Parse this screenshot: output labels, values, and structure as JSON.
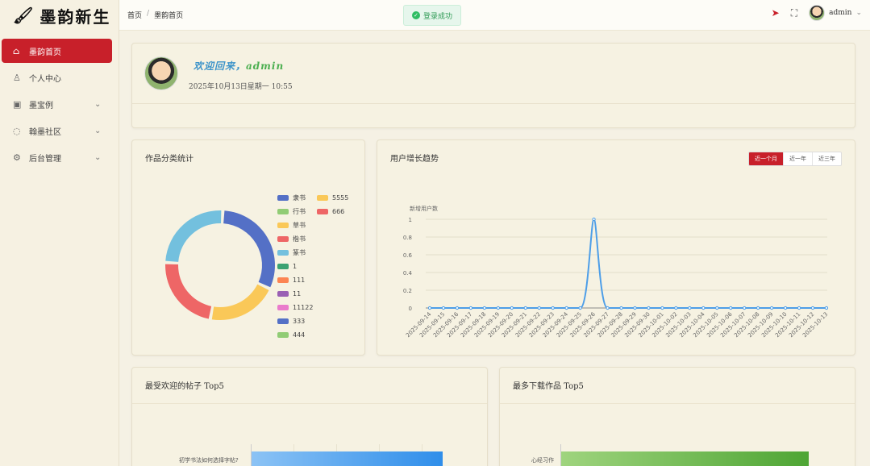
{
  "app": {
    "logo_text": "墨韵新生"
  },
  "sidebar": {
    "items": [
      {
        "label": "墨韵首页",
        "icon": "home-icon",
        "active": true,
        "has_children": false
      },
      {
        "label": "个人中心",
        "icon": "user-icon",
        "active": false,
        "has_children": false
      },
      {
        "label": "墨宝例",
        "icon": "image-icon",
        "active": false,
        "has_children": true
      },
      {
        "label": "翰墨社区",
        "icon": "chat-icon",
        "active": false,
        "has_children": true
      },
      {
        "label": "后台管理",
        "icon": "gear-icon",
        "active": false,
        "has_children": true
      }
    ]
  },
  "header": {
    "breadcrumb": [
      "首页",
      "墨韵首页"
    ],
    "breadcrumb_sep": "/",
    "toast": "登录成功",
    "username": "admin"
  },
  "welcome": {
    "title": "欢迎回来，",
    "name": "admin",
    "datetime": "2025年10月13日星期一 10:55"
  },
  "pie": {
    "title": "作品分类统计",
    "legend_col1": [
      {
        "label": "隶书",
        "color": "#5470c6"
      },
      {
        "label": "行书",
        "color": "#91cc75"
      },
      {
        "label": "草书",
        "color": "#fac858"
      },
      {
        "label": "楷书",
        "color": "#ee6666"
      },
      {
        "label": "篆书",
        "color": "#73c0de"
      },
      {
        "label": "1",
        "color": "#3ba272"
      },
      {
        "label": "111",
        "color": "#fc8452"
      },
      {
        "label": "11",
        "color": "#9a60b4"
      },
      {
        "label": "11122",
        "color": "#ea7ccc"
      },
      {
        "label": "333",
        "color": "#5470c6"
      },
      {
        "label": "444",
        "color": "#91cc75"
      }
    ],
    "legend_col2": [
      {
        "label": "5555",
        "color": "#fac858"
      },
      {
        "label": "666",
        "color": "#ee6666"
      }
    ]
  },
  "trend": {
    "title": "用户增长趋势",
    "tabs": [
      "近一个月",
      "近一年",
      "近三年"
    ],
    "active_tab": 0
  },
  "posts": {
    "title": "最受欢迎的帖子 Top5",
    "bar_label": "初学书法如何选择字帖?"
  },
  "downloads": {
    "title": "最多下载作品 Top5",
    "bar_label": "心经习作"
  },
  "colors": {
    "accent": "#c8202a",
    "line": "#4d9ee8"
  },
  "chart_data": [
    {
      "type": "pie",
      "title": "作品分类统计",
      "categories": [
        "隶书",
        "行书",
        "草书",
        "楷书",
        "篆书",
        "1",
        "111",
        "11",
        "11122",
        "333",
        "444",
        "5555",
        "666"
      ],
      "values": [
        0.3,
        0,
        0.2,
        0.22,
        0.24,
        0,
        0,
        0,
        0,
        0,
        0,
        0,
        0
      ]
    },
    {
      "type": "line",
      "title": "用户增长趋势",
      "ylabel": "新增用户数",
      "ylim": [
        0,
        1
      ],
      "yticks": [
        0,
        0.2,
        0.4,
        0.6,
        0.8,
        1
      ],
      "x": [
        "2025-09-14",
        "2025-09-15",
        "2025-09-16",
        "2025-09-17",
        "2025-09-18",
        "2025-09-19",
        "2025-09-20",
        "2025-09-21",
        "2025-09-22",
        "2025-09-23",
        "2025-09-24",
        "2025-09-25",
        "2025-09-26",
        "2025-09-27",
        "2025-09-28",
        "2025-09-29",
        "2025-09-30",
        "2025-10-01",
        "2025-10-02",
        "2025-10-03",
        "2025-10-04",
        "2025-10-05",
        "2025-10-06",
        "2025-10-07",
        "2025-10-08",
        "2025-10-09",
        "2025-10-10",
        "2025-10-11",
        "2025-10-12",
        "2025-10-13"
      ],
      "values": [
        0,
        0,
        0,
        0,
        0,
        0,
        0,
        0,
        0,
        0,
        0,
        0,
        1,
        0,
        0,
        0,
        0,
        0,
        0,
        0,
        0,
        0,
        0,
        0,
        0,
        0,
        0,
        0,
        0,
        0
      ]
    }
  ]
}
